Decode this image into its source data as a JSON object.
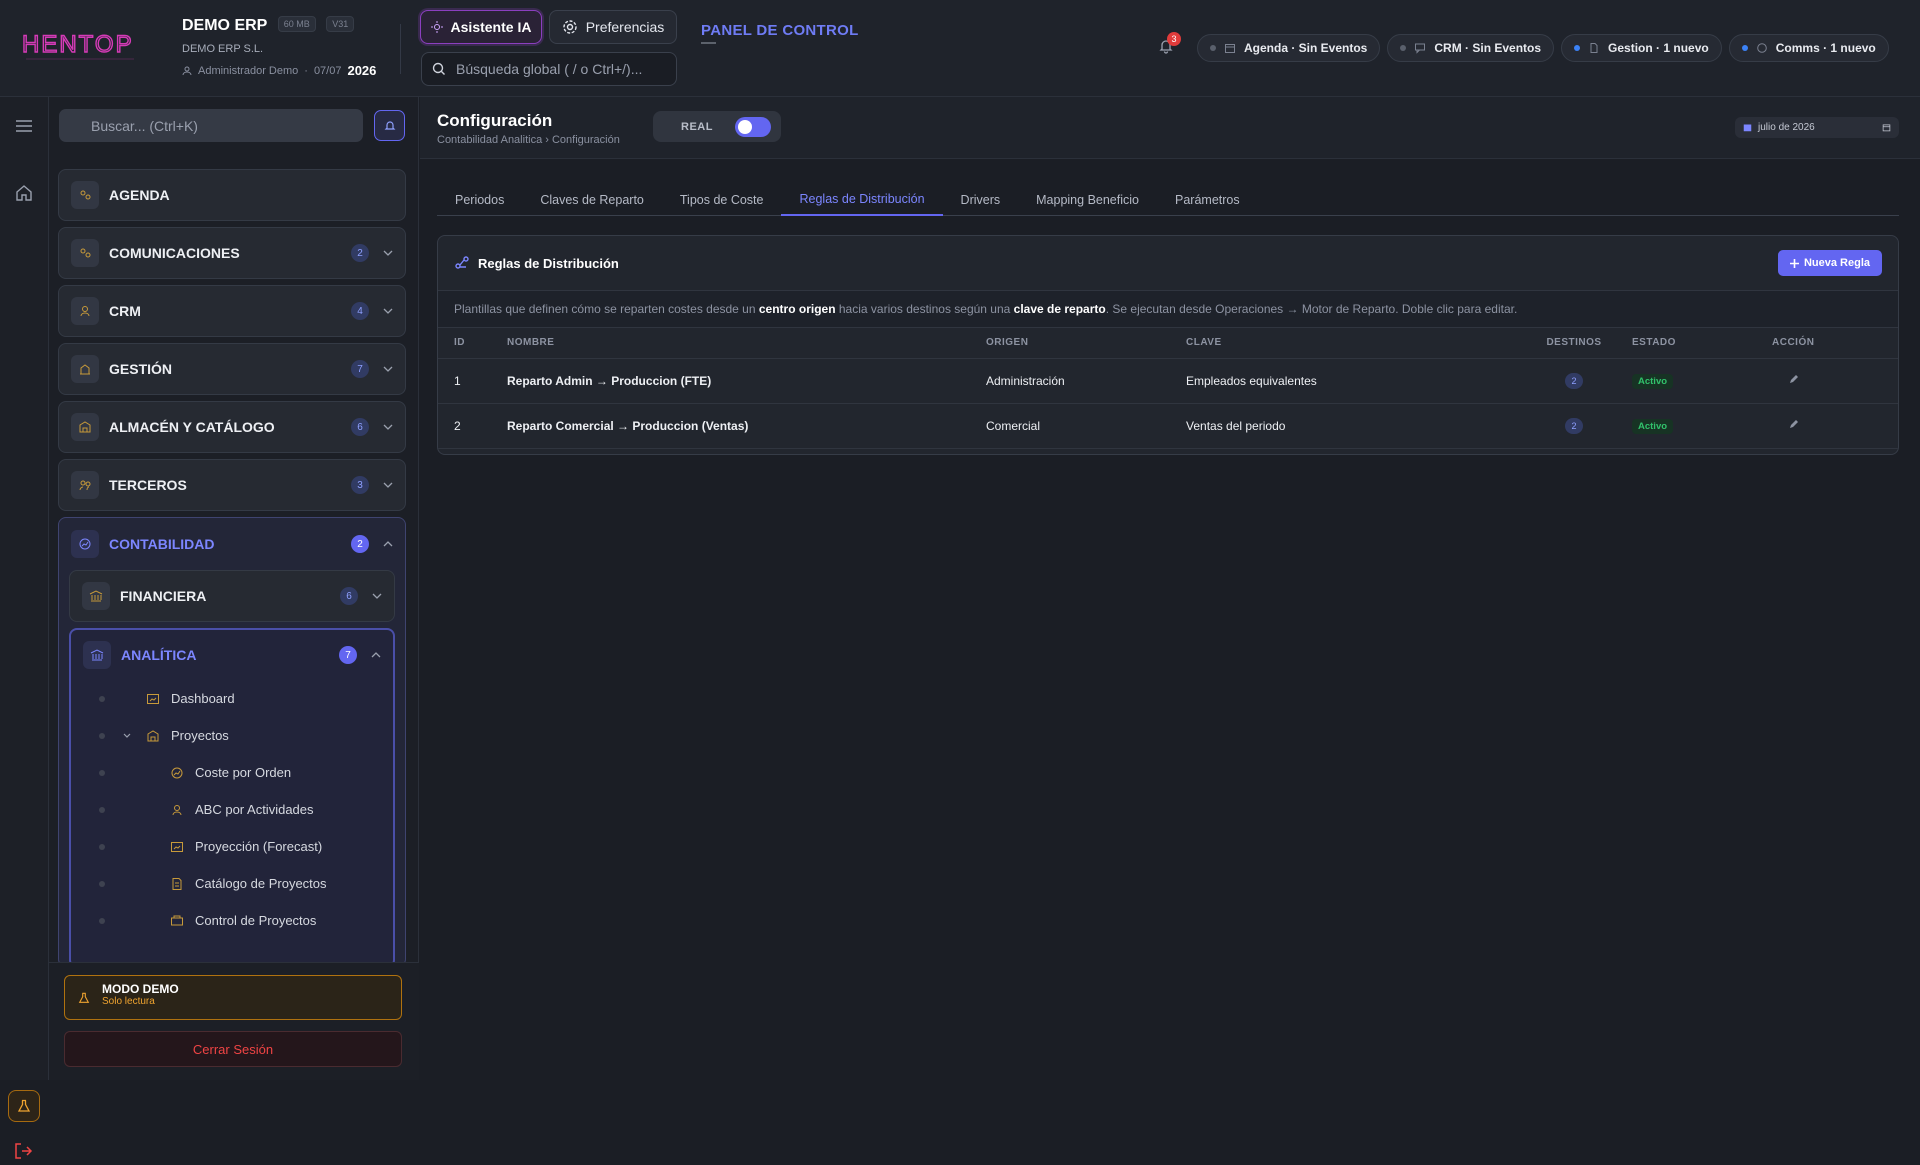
{
  "header": {
    "app_name": "DEMO ERP",
    "size_badge": "60 MB",
    "version_badge": "V31",
    "company": "DEMO ERP S.L.",
    "user": "Administrador Demo",
    "date_short": "07/07",
    "year": "2026",
    "ai_button": "Asistente IA",
    "prefs_button": "Preferencias",
    "search_placeholder": "Búsqueda global ( / o Ctrl+/)...",
    "panel_title": "PANEL DE CONTROL",
    "panel_sub": "—",
    "notifications": "3",
    "chips": [
      {
        "label": "Agenda · Sin Eventos"
      },
      {
        "label": "CRM · Sin Eventos"
      },
      {
        "label": "Gestion · 1 nuevo"
      },
      {
        "label": "Comms · 1 nuevo"
      }
    ]
  },
  "sidebar": {
    "search_placeholder": "Buscar... (Ctrl+K)",
    "items": [
      {
        "label": "AGENDA"
      },
      {
        "label": "COMUNICACIONES",
        "count": "2"
      },
      {
        "label": "CRM",
        "count": "4"
      },
      {
        "label": "GESTIÓN",
        "count": "7"
      },
      {
        "label": "ALMACÉN Y CATÁLOGO",
        "count": "6"
      },
      {
        "label": "TERCEROS",
        "count": "3"
      }
    ],
    "open_group": {
      "label": "CONTABILIDAD",
      "count": "2",
      "financiera": {
        "label": "FINANCIERA",
        "count": "6"
      },
      "analitica": {
        "label": "ANALÍTICA",
        "count": "7",
        "leaves": [
          "Dashboard",
          "Proyectos",
          "Coste por Orden",
          "ABC por Actividades",
          "Proyección (Forecast)",
          "Catálogo de Proyectos",
          "Control de Proyectos"
        ]
      }
    },
    "demo_title": "MODO DEMO",
    "demo_sub": "Solo lectura",
    "logout": "Cerrar Sesión"
  },
  "page": {
    "title": "Configuración",
    "breadcrumb_1": "Contabilidad Analitica",
    "breadcrumb_sep": "›",
    "breadcrumb_2": "Configuración",
    "toggle_label": "REAL",
    "date": "julio de 2026",
    "tabs": [
      "Periodos",
      "Claves de Reparto",
      "Tipos de Coste",
      "Reglas de Distribución",
      "Drivers",
      "Mapping Beneficio",
      "Parámetros"
    ],
    "card_title": "Reglas de Distribución",
    "new_button": "Nueva Regla",
    "desc_1": "Plantillas que definen cómo se reparten costes desde un ",
    "desc_b1": "centro origen",
    "desc_2": " hacia varios destinos según una ",
    "desc_b2": "clave de reparto",
    "desc_3": ". Se ejecutan desde Operaciones → Motor de Reparto. Doble clic para editar.",
    "columns": [
      "ID",
      "NOMBRE",
      "ORIGEN",
      "CLAVE",
      "DESTINOS",
      "ESTADO",
      "ACCIÓN"
    ],
    "rows": [
      {
        "id": "1",
        "nombre": "Reparto Admin → Produccion (FTE)",
        "origen": "Administración",
        "clave": "Empleados equivalentes",
        "destinos": "2",
        "estado": "Activo"
      },
      {
        "id": "2",
        "nombre": "Reparto Comercial → Produccion (Ventas)",
        "origen": "Comercial",
        "clave": "Ventas del periodo",
        "destinos": "2",
        "estado": "Activo"
      }
    ]
  },
  "colors": {
    "accent": "#6366f1",
    "brand": "#d63bb8",
    "danger": "#ef4444",
    "warning": "#f0a430",
    "success": "#31c26b"
  }
}
